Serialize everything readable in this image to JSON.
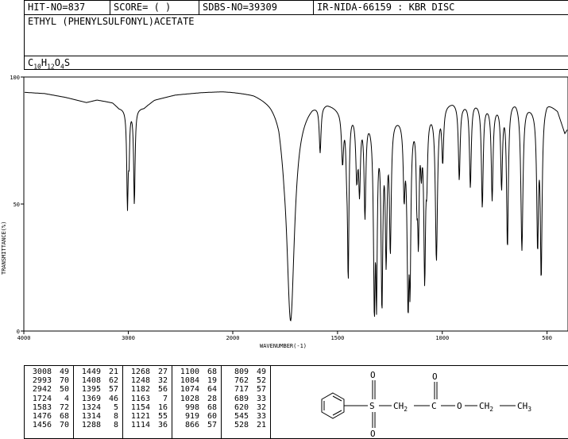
{
  "header": {
    "hit_no": "HIT-NO=837",
    "score": "SCORE=  (   )",
    "sdbs_no": "SDBS-NO=39309",
    "ir_no": "IR-NIDA-66159 : KBR DISC",
    "compound_name": "ETHYL (PHENYLSULFONYL)ACETATE",
    "formula": {
      "c": "C",
      "c_n": "10",
      "h": "H",
      "h_n": "12",
      "o": "O",
      "o_n": "4",
      "s": "S"
    }
  },
  "chart_data": {
    "type": "line",
    "xlabel": "WAVENUMBER(-1)",
    "ylabel": "TRANSMITTANCE(%)",
    "xlim": [
      4000,
      400
    ],
    "ylim": [
      0,
      100
    ],
    "xticks": [
      "4000",
      "3000",
      "2000",
      "1500",
      "1000",
      "500"
    ],
    "yticks": [
      "100",
      "50",
      "0"
    ],
    "grid": false,
    "line_color": "#000000",
    "baseline": [
      [
        4000,
        94
      ],
      [
        3800,
        93.5
      ],
      [
        3600,
        92
      ],
      [
        3400,
        90
      ],
      [
        3300,
        91
      ],
      [
        3150,
        90
      ],
      [
        3090,
        88
      ],
      [
        2850,
        88
      ],
      [
        2750,
        91
      ],
      [
        2550,
        93
      ],
      [
        2300,
        94
      ],
      [
        2100,
        94.5
      ],
      [
        2000,
        94.5
      ],
      [
        1900,
        94
      ],
      [
        1820,
        92
      ],
      [
        1780,
        90
      ],
      [
        1755,
        82
      ],
      [
        1680,
        88
      ],
      [
        1620,
        91
      ],
      [
        1550,
        91
      ],
      [
        1500,
        89
      ],
      [
        1400,
        88
      ],
      [
        1350,
        86
      ],
      [
        1300,
        85
      ],
      [
        1200,
        86
      ],
      [
        1100,
        87
      ],
      [
        1000,
        90
      ],
      [
        950,
        91
      ],
      [
        900,
        90
      ],
      [
        850,
        91
      ],
      [
        800,
        90
      ],
      [
        750,
        89
      ],
      [
        700,
        91
      ],
      [
        650,
        92
      ],
      [
        600,
        90
      ],
      [
        550,
        88
      ],
      [
        500,
        91
      ],
      [
        450,
        87
      ],
      [
        415,
        78
      ],
      [
        400,
        80
      ]
    ],
    "peaks": [
      {
        "wn": 3008,
        "t": 49,
        "w": 8
      },
      {
        "wn": 2993,
        "t": 70,
        "w": 6
      },
      {
        "wn": 2942,
        "t": 50,
        "w": 8
      },
      {
        "wn": 1724,
        "t": 4,
        "w": 22
      },
      {
        "wn": 1583,
        "t": 72,
        "w": 5
      },
      {
        "wn": 1476,
        "t": 68,
        "w": 6
      },
      {
        "wn": 1456,
        "t": 70,
        "w": 5
      },
      {
        "wn": 1449,
        "t": 21,
        "w": 4
      },
      {
        "wn": 1408,
        "t": 62,
        "w": 6
      },
      {
        "wn": 1395,
        "t": 57,
        "w": 5
      },
      {
        "wn": 1369,
        "w": 5,
        "t": 46
      },
      {
        "wn": 1324,
        "t": 5,
        "w": 5
      },
      {
        "wn": 1314,
        "t": 8,
        "w": 4
      },
      {
        "wn": 1288,
        "t": 8,
        "w": 5
      },
      {
        "wn": 1268,
        "t": 27,
        "w": 5
      },
      {
        "wn": 1248,
        "t": 32,
        "w": 5
      },
      {
        "wn": 1182,
        "t": 56,
        "w": 5
      },
      {
        "wn": 1163,
        "t": 7,
        "w": 6
      },
      {
        "wn": 1154,
        "t": 16,
        "w": 4
      },
      {
        "wn": 1121,
        "t": 55,
        "w": 4
      },
      {
        "wn": 1114,
        "t": 36,
        "w": 4
      },
      {
        "wn": 1100,
        "t": 68,
        "w": 4
      },
      {
        "wn": 1084,
        "t": 19,
        "w": 5
      },
      {
        "wn": 1074,
        "t": 64,
        "w": 4
      },
      {
        "wn": 1028,
        "t": 28,
        "w": 6
      },
      {
        "wn": 998,
        "t": 68,
        "w": 5
      },
      {
        "wn": 919,
        "t": 60,
        "w": 5
      },
      {
        "wn": 866,
        "t": 57,
        "w": 5
      },
      {
        "wn": 809,
        "t": 49,
        "w": 5
      },
      {
        "wn": 762,
        "t": 52,
        "w": 5
      },
      {
        "wn": 717,
        "t": 57,
        "w": 5
      },
      {
        "wn": 689,
        "t": 33,
        "w": 5
      },
      {
        "wn": 620,
        "t": 32,
        "w": 6
      },
      {
        "wn": 545,
        "t": 33,
        "w": 5
      },
      {
        "wn": 528,
        "t": 21,
        "w": 5
      }
    ],
    "peak_table": [
      [
        [
          "3008",
          "49"
        ],
        [
          "2993",
          "70"
        ],
        [
          "2942",
          "50"
        ],
        [
          "1724",
          "4"
        ],
        [
          "1583",
          "72"
        ],
        [
          "1476",
          "68"
        ],
        [
          "1456",
          "70"
        ]
      ],
      [
        [
          "1449",
          "21"
        ],
        [
          "1408",
          "62"
        ],
        [
          "1395",
          "57"
        ],
        [
          "1369",
          "46"
        ],
        [
          "1324",
          "5"
        ],
        [
          "1314",
          "8"
        ],
        [
          "1288",
          "8"
        ]
      ],
      [
        [
          "1268",
          "27"
        ],
        [
          "1248",
          "32"
        ],
        [
          "1182",
          "56"
        ],
        [
          "1163",
          "7"
        ],
        [
          "1154",
          "16"
        ],
        [
          "1121",
          "55"
        ],
        [
          "1114",
          "36"
        ]
      ],
      [
        [
          "1100",
          "68"
        ],
        [
          "1084",
          "19"
        ],
        [
          "1074",
          "64"
        ],
        [
          "1028",
          "28"
        ],
        [
          "998",
          "68"
        ],
        [
          "919",
          "60"
        ],
        [
          "866",
          "57"
        ]
      ],
      [
        [
          "809",
          "49"
        ],
        [
          "762",
          "52"
        ],
        [
          "717",
          "57"
        ],
        [
          "689",
          "33"
        ],
        [
          "620",
          "32"
        ],
        [
          "545",
          "33"
        ],
        [
          "528",
          "21"
        ]
      ]
    ]
  },
  "structure": {
    "o_top1": "O",
    "o_top2": "O",
    "o_bottom": "O",
    "s": "S",
    "o_ester": "O",
    "ch2_a": "CH",
    "ch2_a_sub": "2",
    "ch2_b": "CH",
    "ch2_b_sub": "2",
    "ch3": "CH",
    "ch3_sub": "3",
    "c": "C"
  }
}
